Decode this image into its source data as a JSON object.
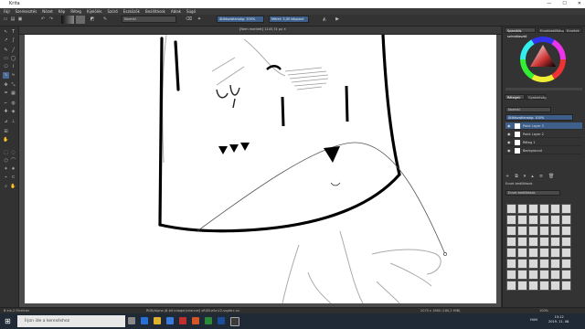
{
  "window": {
    "title": "Krita",
    "minimize": "—",
    "maximize": "☐",
    "close": "✕"
  },
  "menu": [
    "Fájl",
    "Szerkesztés",
    "Nézet",
    "Kép",
    "Réteg",
    "Kijelölés",
    "Szűrő",
    "Eszközök",
    "Beállítások",
    "Ablak",
    "Súgó"
  ],
  "toolbar": {
    "blend_mode": "Normál",
    "opacity_label": "Átlátszatlanság: 100%",
    "size_label": "Méret: 3,00 képpont"
  },
  "canvas": {
    "tab_label": "[Nem mentett] 1145,74 px ✕"
  },
  "status": {
    "left": "B Ink-2 Fineliner",
    "center": "RGB/Alpha (8-bit integer/channel)  sRGB-elle-V2-srgbtrc.icc",
    "right": "2070 x 1660 (180,2 MiB)",
    "zoom": "100%"
  },
  "dock": {
    "color_tab": "Speciális színválasztó",
    "brush_tab_a": "Ecsetbeállítások",
    "brush_tab_b": "Ecsetek",
    "layers_tab": "Rétegek",
    "layers_tab2": "Gyakoriság",
    "layer_mode": "Normál",
    "layer_opacity": "Átlátszatlanság: 100%",
    "layers": [
      "Paint Layer 3",
      "Paint Layer 2",
      "Réteg 1",
      "Background"
    ],
    "brush_presets_label": "Ecset beállítások",
    "brush_filter": "Ecset beállítások"
  },
  "taskbar": {
    "search_placeholder": "Írjon ide a kereséshez",
    "time": "15:12",
    "date": "2019. 11. 08.",
    "lang": "HUN"
  },
  "colors": {
    "accent": "#3d5f8a",
    "toolbar_bg": "#333333",
    "canvas_bg": "#ffffff"
  }
}
